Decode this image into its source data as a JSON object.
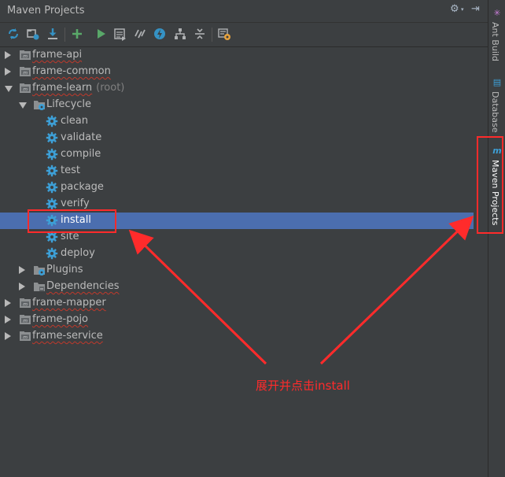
{
  "panel": {
    "title": "Maven Projects",
    "title_icons": [
      "gear-icon",
      "hide-panel-icon"
    ]
  },
  "toolbar": {
    "buttons": [
      {
        "name": "reimport-icon",
        "color": "#3592c4"
      },
      {
        "name": "generate-sources-icon",
        "color": "#afb1b3"
      },
      {
        "name": "download-icon",
        "color": "#3592c4"
      },
      {
        "name": "add-icon",
        "color": "#59a869"
      },
      {
        "name": "run-icon",
        "color": "#59a869"
      },
      {
        "name": "execute-goal-icon",
        "color": "#afb1b3"
      },
      {
        "name": "toggle-offline-icon",
        "color": "#afb1b3"
      },
      {
        "name": "skip-tests-icon",
        "color": "#3592c4"
      },
      {
        "name": "show-dependencies-icon",
        "color": "#afb1b3"
      },
      {
        "name": "collapse-all-icon",
        "color": "#afb1b3"
      },
      {
        "name": "settings-icon",
        "color": "#e8a33e"
      }
    ]
  },
  "tree": {
    "items": [
      {
        "label": "frame-api",
        "suffix": "",
        "level": 0,
        "expander": "collapsed",
        "icon": "maven-module-icon",
        "squiggle": true
      },
      {
        "label": "frame-common",
        "suffix": "",
        "level": 0,
        "expander": "collapsed",
        "icon": "maven-module-icon",
        "squiggle": true
      },
      {
        "label": "frame-learn",
        "suffix": "(root)",
        "level": 0,
        "expander": "expanded",
        "icon": "maven-module-icon",
        "squiggle": true
      },
      {
        "label": "Lifecycle",
        "suffix": "",
        "level": 1,
        "expander": "expanded",
        "icon": "lifecycle-folder-icon",
        "squiggle": false
      },
      {
        "label": "clean",
        "suffix": "",
        "level": 2,
        "expander": "none",
        "icon": "goal-gear-icon",
        "squiggle": false
      },
      {
        "label": "validate",
        "suffix": "",
        "level": 2,
        "expander": "none",
        "icon": "goal-gear-icon",
        "squiggle": false
      },
      {
        "label": "compile",
        "suffix": "",
        "level": 2,
        "expander": "none",
        "icon": "goal-gear-icon",
        "squiggle": false
      },
      {
        "label": "test",
        "suffix": "",
        "level": 2,
        "expander": "none",
        "icon": "goal-gear-icon",
        "squiggle": false
      },
      {
        "label": "package",
        "suffix": "",
        "level": 2,
        "expander": "none",
        "icon": "goal-gear-icon",
        "squiggle": false
      },
      {
        "label": "verify",
        "suffix": "",
        "level": 2,
        "expander": "none",
        "icon": "goal-gear-icon",
        "squiggle": false
      },
      {
        "label": "install",
        "suffix": "",
        "level": 2,
        "expander": "none",
        "icon": "goal-gear-icon",
        "squiggle": false,
        "selected": true
      },
      {
        "label": "site",
        "suffix": "",
        "level": 2,
        "expander": "none",
        "icon": "goal-gear-icon",
        "squiggle": false
      },
      {
        "label": "deploy",
        "suffix": "",
        "level": 2,
        "expander": "none",
        "icon": "goal-gear-icon",
        "squiggle": false
      },
      {
        "label": "Plugins",
        "suffix": "",
        "level": 1,
        "expander": "collapsed",
        "icon": "plugins-folder-icon",
        "squiggle": false
      },
      {
        "label": "Dependencies",
        "suffix": "",
        "level": 1,
        "expander": "collapsed",
        "icon": "dependencies-folder-icon",
        "squiggle": true
      },
      {
        "label": "frame-mapper",
        "suffix": "",
        "level": 0,
        "expander": "collapsed",
        "icon": "maven-module-icon",
        "squiggle": true
      },
      {
        "label": "frame-pojo",
        "suffix": "",
        "level": 0,
        "expander": "collapsed",
        "icon": "maven-module-icon",
        "squiggle": true
      },
      {
        "label": "frame-service",
        "suffix": "",
        "level": 0,
        "expander": "collapsed",
        "icon": "maven-module-icon",
        "squiggle": true
      }
    ]
  },
  "sidebar": {
    "tabs": [
      {
        "label": "Ant Build",
        "icon": "ant-build-icon",
        "active": false
      },
      {
        "label": "Database",
        "icon": "database-icon",
        "active": false
      },
      {
        "label": "Maven Projects",
        "icon": "maven-m-icon",
        "active": true
      }
    ]
  },
  "annotation": {
    "text": "展开并点击install",
    "color": "#ff2b2b"
  },
  "colors": {
    "background": "#3c3f41",
    "selection": "#4b6eaf",
    "text": "#bbbbbb",
    "goal_icon": "#3d9fd6",
    "highlight": "#ff2b2b"
  }
}
